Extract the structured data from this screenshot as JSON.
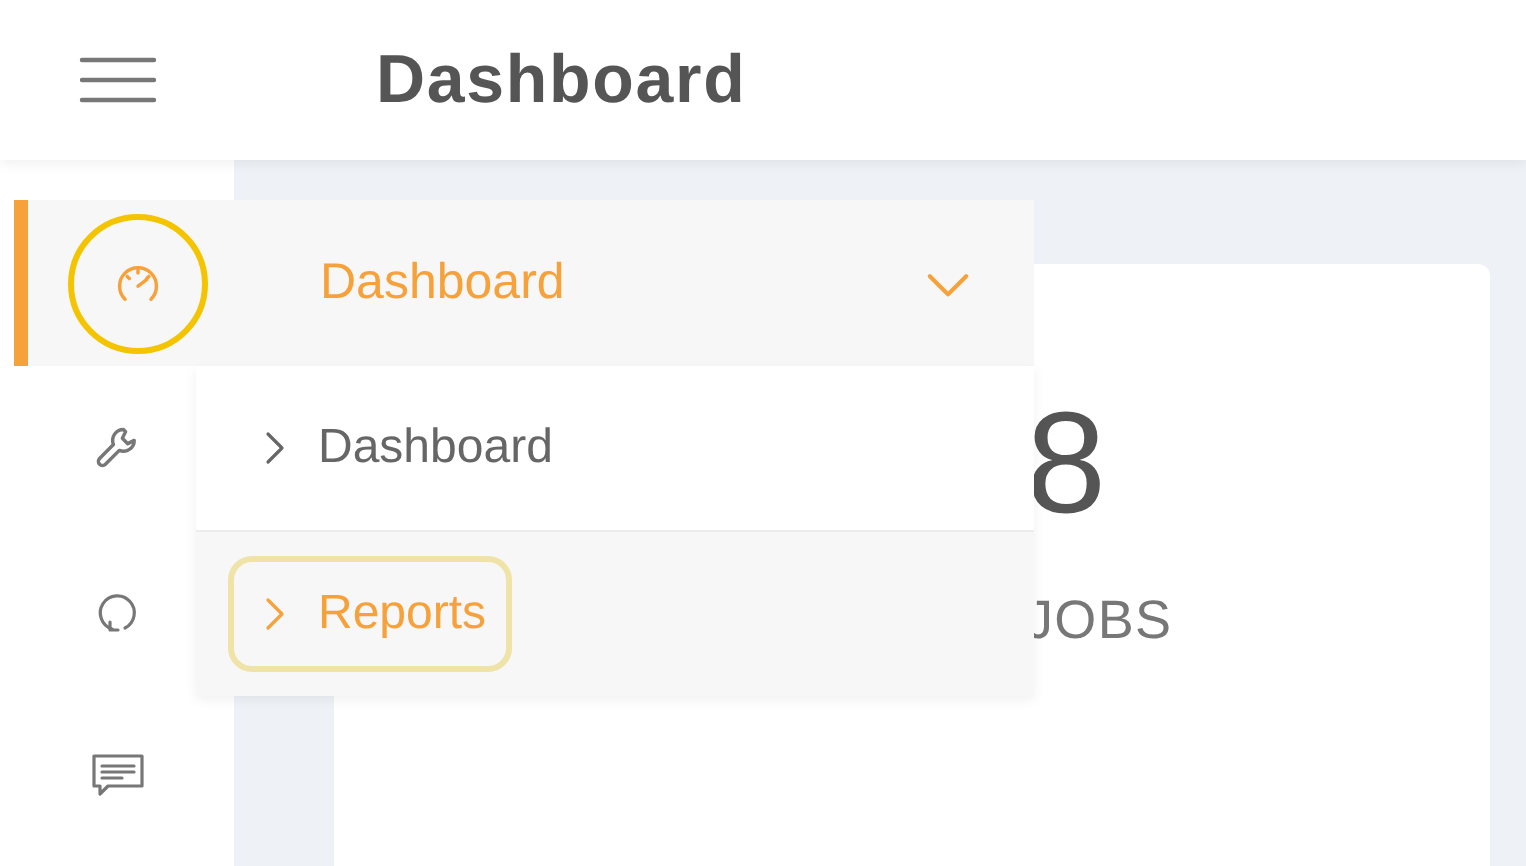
{
  "header": {
    "title": "Dashboard"
  },
  "nav": [
    {
      "kind": "gauge",
      "label": "Dashboard",
      "expanded": true,
      "children": [
        {
          "label": "Dashboard",
          "selected": false
        },
        {
          "label": "Reports",
          "selected": true
        }
      ]
    },
    {
      "kind": "wrench"
    },
    {
      "kind": "refresh"
    },
    {
      "kind": "chat"
    }
  ],
  "card": {
    "value": "8",
    "label": "JOBS"
  }
}
